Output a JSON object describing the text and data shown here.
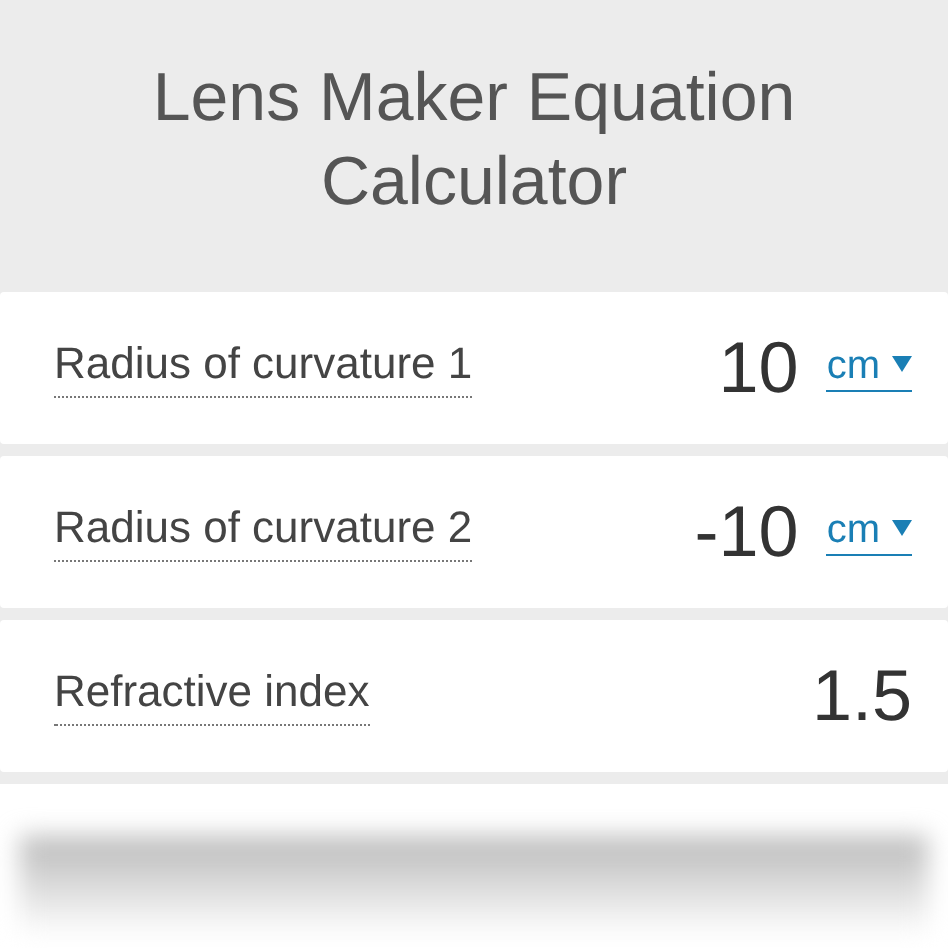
{
  "title": "Lens Maker Equation Calculator",
  "rows": [
    {
      "label": "Radius of curvature 1",
      "value": "10",
      "unit": "cm"
    },
    {
      "label": "Radius of curvature 2",
      "value": "-10",
      "unit": "cm"
    },
    {
      "label": "Refractive index",
      "value": "1.5"
    }
  ],
  "cut_row": true
}
